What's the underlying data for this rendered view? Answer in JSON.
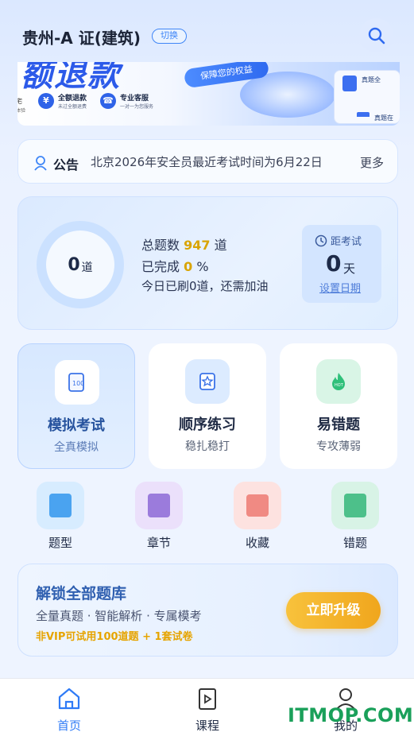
{
  "header": {
    "title": "贵州-A 证(建筑)",
    "switch_label": "切换",
    "search_icon": "search-icon"
  },
  "banner": {
    "headline": "额退款",
    "pill": "保障您的权益",
    "features": [
      {
        "title": "全额退款",
        "sub": "未过全额退费",
        "icon": "¥"
      },
      {
        "title": "专业客服",
        "sub": "一对一为您服务",
        "icon": "☎"
      }
    ],
    "edge_label": "宅",
    "edge_sub": "体验",
    "card_top": "真题全",
    "card_bottom": "真题在"
  },
  "notice": {
    "label": "公告",
    "text": "北京2026年安全员最近考试时间为6月22日",
    "more": "更多"
  },
  "stats": {
    "done_count": "0",
    "done_unit": "道",
    "total_prefix": "总题数",
    "total_value": "947",
    "total_suffix": "道",
    "completed_prefix": "已完成",
    "completed_value": "0",
    "completed_suffix": "%",
    "tip": "今日已刷0道，还需加油",
    "countdown_label": "距考试",
    "countdown_value": "0",
    "countdown_unit": "天",
    "set_date": "设置日期"
  },
  "modes": [
    {
      "title": "模拟考试",
      "sub": "全真模拟",
      "icon": "exam-paper-icon",
      "active": true
    },
    {
      "title": "顺序练习",
      "sub": "稳扎稳打",
      "icon": "star-book-icon",
      "active": false
    },
    {
      "title": "易错题",
      "sub": "专攻薄弱",
      "icon": "hot-fire-icon",
      "active": false
    }
  ],
  "shortcuts": [
    {
      "label": "题型",
      "color": "#4aa3f0"
    },
    {
      "label": "章节",
      "color": "#9b7bdc"
    },
    {
      "label": "收藏",
      "color": "#f08a83"
    },
    {
      "label": "错题",
      "color": "#4dc08a"
    }
  ],
  "vip": {
    "title": "解锁全部题库",
    "sub": "全量真题 · 智能解析 · 专属模考",
    "note": "非VIP可试用100道题 + 1套试卷",
    "button": "立即升级"
  },
  "nav": {
    "items": [
      {
        "label": "首页",
        "icon": "home-icon",
        "active": true
      },
      {
        "label": "课程",
        "icon": "course-play-icon",
        "active": false
      },
      {
        "label": "我的",
        "icon": "profile-icon",
        "active": false
      }
    ]
  },
  "watermark": "ITMOP.COM"
}
